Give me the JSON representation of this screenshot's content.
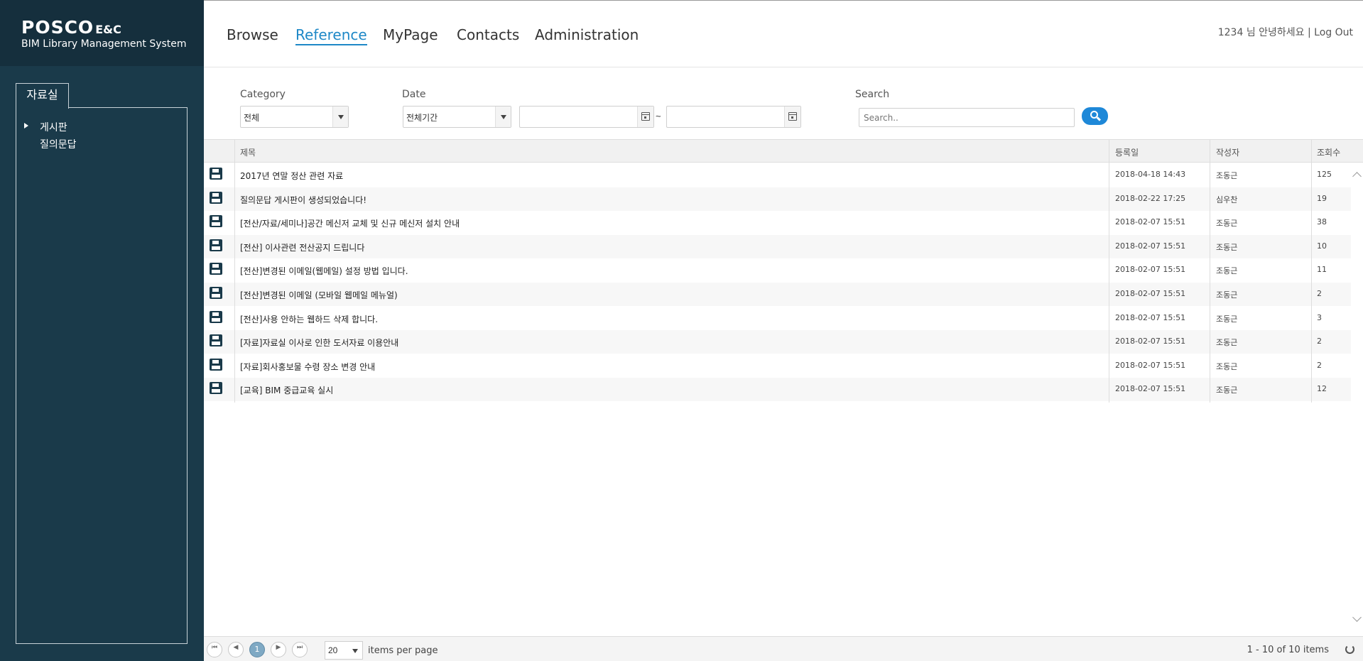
{
  "brand": {
    "logo_main": "POSCO",
    "logo_suffix": "E&C",
    "system_name": "BIM Library Management System"
  },
  "sidebar": {
    "panel_title": "자료실",
    "items": [
      {
        "label": "게시판",
        "expanded": false,
        "has_arrow": true
      },
      {
        "label": "질의문답",
        "expanded": false,
        "has_arrow": false
      }
    ]
  },
  "nav": {
    "items": [
      {
        "label": "Browse",
        "active": false
      },
      {
        "label": "Reference",
        "active": true
      },
      {
        "label": "MyPage",
        "active": false
      },
      {
        "label": "Contacts",
        "active": false
      },
      {
        "label": "Administration",
        "active": false
      }
    ],
    "user_greeting": "1234 님 안녕하세요 | Log Out"
  },
  "filters": {
    "category_label": "Category",
    "category_value": "전체",
    "date_label": "Date",
    "date_value": "전체기간",
    "date_from": "",
    "date_to": "",
    "date_separator": "~",
    "search_label": "Search",
    "search_placeholder": "Search.."
  },
  "table": {
    "columns": [
      "제목",
      "등록일",
      "작성자",
      "조회수"
    ],
    "rows": [
      {
        "title": "2017년 연말 정산 관련 자료",
        "date": "2018-04-18 14:43",
        "author": "조동근",
        "views": "125"
      },
      {
        "title": "질의문답 게시판이 생성되었습니다!",
        "date": "2018-02-22 17:25",
        "author": "심우찬",
        "views": "19"
      },
      {
        "title": "[전산/자료/세미나]공간 메신저 교체 및 신규 메신저 설치 안내",
        "date": "2018-02-07 15:51",
        "author": "조동근",
        "views": "38"
      },
      {
        "title": "[전산] 이사관련 전산공지 드립니다",
        "date": "2018-02-07 15:51",
        "author": "조동근",
        "views": "10"
      },
      {
        "title": "[전산]변경된 이메일(웹메일) 설정 방법 입니다.",
        "date": "2018-02-07 15:51",
        "author": "조동근",
        "views": "11"
      },
      {
        "title": "[전산]변경된 이메일 (모바일 웹메일 메뉴얼)",
        "date": "2018-02-07 15:51",
        "author": "조동근",
        "views": "2"
      },
      {
        "title": "[전산]사용 안하는 웹하드 삭제 합니다.",
        "date": "2018-02-07 15:51",
        "author": "조동근",
        "views": "3"
      },
      {
        "title": "[자료]자료실 이사로 인한 도서자료 이용안내",
        "date": "2018-02-07 15:51",
        "author": "조동근",
        "views": "2"
      },
      {
        "title": "[자료]회사홍보물 수령 장소 변경 안내",
        "date": "2018-02-07 15:51",
        "author": "조동근",
        "views": "2"
      },
      {
        "title": "[교육] BIM 중급교육 실시",
        "date": "2018-02-07 15:51",
        "author": "조동근",
        "views": "12"
      }
    ],
    "row_icon": "save-disk-icon"
  },
  "pager": {
    "current_page": "1",
    "per_page": "20",
    "per_page_label": "items per page",
    "count_text": "1 - 10 of 10 items"
  },
  "colors": {
    "sidebar_bg": "#1a3a4a",
    "accent": "#1e88c7",
    "search_button": "#1e88d8"
  }
}
